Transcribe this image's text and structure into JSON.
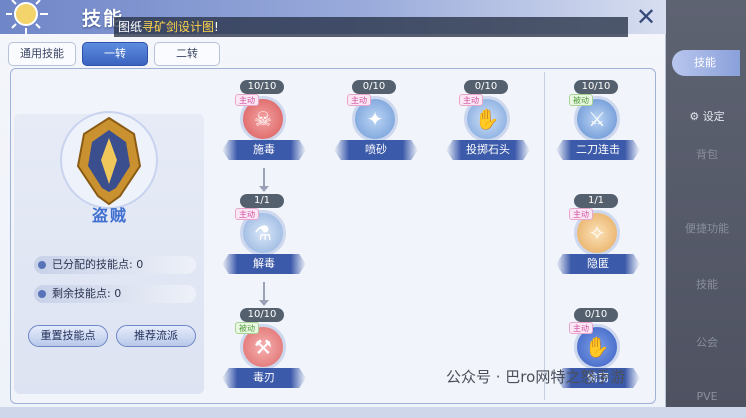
{
  "window": {
    "title": "技能",
    "close_icon": "close-x-icon"
  },
  "ticker": {
    "prefix": "图纸",
    "highlight": "寻矿剑设计图",
    "suffix": "!"
  },
  "tabs": [
    {
      "label": "通用技能"
    },
    {
      "label": "一转"
    },
    {
      "label": "二转"
    }
  ],
  "class": {
    "name": "盗贼"
  },
  "stats": {
    "allocated_label": "已分配的技能点: 0",
    "remaining_label": "剩余技能点: 0"
  },
  "buttons": {
    "reset": "重置技能点",
    "recommend": "推荐流派"
  },
  "skills": [
    {
      "level": "10/10",
      "type": "主动",
      "name": "施毒"
    },
    {
      "level": "0/10",
      "type": "主动",
      "name": "喷砂"
    },
    {
      "level": "0/10",
      "type": "主动",
      "name": "投掷石头"
    },
    {
      "level": "10/10",
      "type": "被动",
      "name": "二刀连击"
    },
    {
      "level": "1/1",
      "type": "主动",
      "name": "解毒"
    },
    {
      "level": "1/1",
      "type": "主动",
      "name": "隐匿"
    },
    {
      "level": "10/10",
      "type": "被动",
      "name": "毒刃"
    },
    {
      "level": "0/10",
      "type": "主动",
      "name": "偷窃"
    }
  ],
  "sidebar": {
    "active": "技能",
    "items": [
      "设定",
      "背包",
      "便捷功能",
      "技能",
      "公会",
      "PVE"
    ]
  },
  "watermark": "公众号 · 巴ro网特之怒手游"
}
